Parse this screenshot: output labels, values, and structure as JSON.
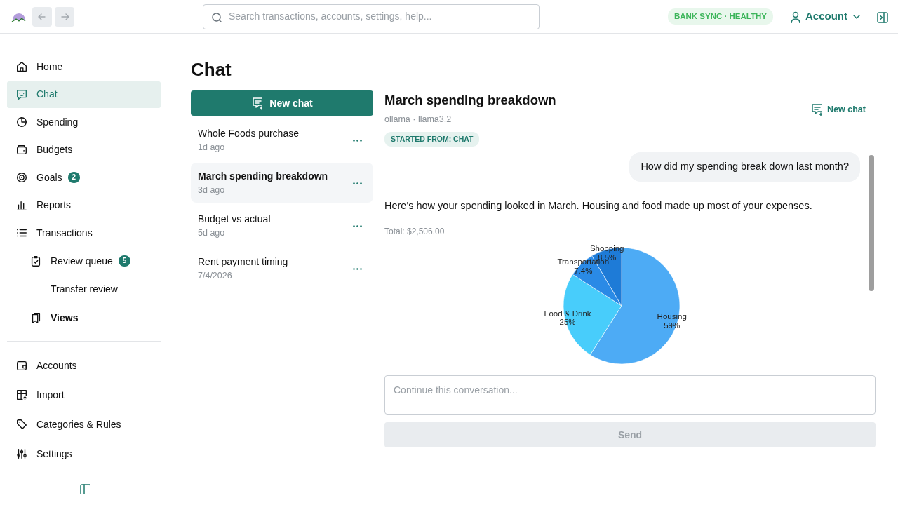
{
  "topbar": {
    "back": {
      "disabled": true
    },
    "forward": {
      "disabled": true
    },
    "search": {
      "placeholder": "Search transactions, accounts, settings, help..."
    },
    "sync_badge": "BANK SYNC · HEALTHY",
    "account": "Account"
  },
  "sidebar": {
    "main": [
      {
        "label": "Home",
        "selected": false
      },
      {
        "label": "Chat",
        "selected": true
      },
      {
        "label": "Spending",
        "selected": false
      },
      {
        "label": "Budgets",
        "selected": false
      },
      {
        "label": "Goals",
        "selected": false,
        "badge": "2"
      },
      {
        "label": "Reports",
        "selected": false
      },
      {
        "label": "Transactions",
        "selected": false,
        "children": [
          {
            "label": "Review queue",
            "kind": "link",
            "selected": false,
            "badge": "5"
          },
          {
            "label": "Transfer review",
            "kind": "link",
            "selected": false
          },
          {
            "label": "Views",
            "kind": "group",
            "selected": false
          }
        ]
      }
    ],
    "bottom": [
      {
        "label": "Accounts",
        "selected": false
      },
      {
        "label": "Import",
        "selected": false
      },
      {
        "label": "Categories & Rules",
        "selected": false
      },
      {
        "label": "Settings",
        "selected": false
      }
    ]
  },
  "page_title": "Chat",
  "new_chat_button": "New chat",
  "conversations": [
    {
      "title": "Whole Foods purchase",
      "time": "1d ago",
      "selected": false
    },
    {
      "title": "March spending breakdown",
      "time": "3d ago",
      "selected": true
    },
    {
      "title": "Budget vs actual",
      "time": "5d ago",
      "selected": false
    },
    {
      "title": "Rent payment timing",
      "time": "7/4/2026",
      "selected": false
    }
  ],
  "chat": {
    "title": "March spending breakdown",
    "subtitle": "ollama · llama3.2",
    "origin_badge": "STARTED FROM: CHAT",
    "new_chat": "New chat",
    "messages": [
      {
        "kind": "user",
        "text": "How did my spending break down last month?"
      },
      {
        "kind": "assistant",
        "text": "Here's how your spending looked in March. Housing and food made up most of your expenses.",
        "total": "Total: $2,506.00",
        "chart_data": {
          "type": "pie",
          "categories": [
            "Housing",
            "Food & Drink",
            "Transportation",
            "Shopping"
          ],
          "values": [
            59,
            25,
            7.4,
            8.5
          ],
          "colors": [
            "#4dabf5",
            "#48cdfb",
            "#2a8ae6",
            "#1e7bd7"
          ],
          "value_labels": [
            "59%",
            "25%",
            "7.4%",
            "8.5%"
          ]
        }
      }
    ]
  },
  "composer": {
    "placeholder": "Continue this conversation...",
    "send": {
      "label": "Send",
      "disabled": true
    }
  }
}
